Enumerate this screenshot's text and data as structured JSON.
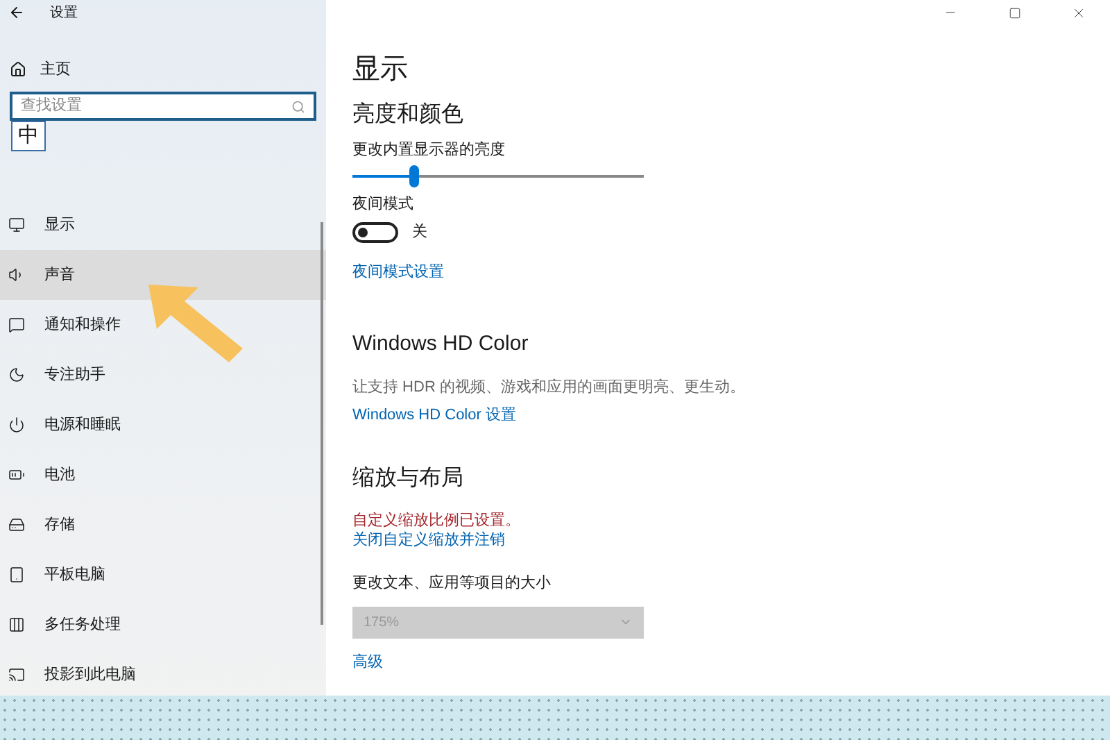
{
  "window": {
    "title": "设置"
  },
  "sidebar": {
    "home": "主页",
    "search": {
      "placeholder": "查找设置"
    },
    "ime": "中",
    "items": [
      {
        "label": "显示",
        "selected": false
      },
      {
        "label": "声音",
        "selected": true
      },
      {
        "label": "通知和操作",
        "selected": false
      },
      {
        "label": "专注助手",
        "selected": false
      },
      {
        "label": "电源和睡眠",
        "selected": false
      },
      {
        "label": "电池",
        "selected": false
      },
      {
        "label": "存储",
        "selected": false
      },
      {
        "label": "平板电脑",
        "selected": false
      },
      {
        "label": "多任务处理",
        "selected": false
      },
      {
        "label": "投影到此电脑",
        "selected": false
      }
    ]
  },
  "content": {
    "title": "显示",
    "brightness": {
      "heading": "亮度和颜色",
      "label": "更改内置显示器的亮度",
      "level": 0.21
    },
    "night_light": {
      "label": "夜间模式",
      "on": false,
      "state_text": "关",
      "link": "夜间模式设置"
    },
    "hd_color": {
      "heading": "Windows HD Color",
      "description": "让支持 HDR 的视频、游戏和应用的画面更明亮、更生动。",
      "link": "Windows HD Color 设置"
    },
    "scale": {
      "heading": "缩放与布局",
      "warning": "自定义缩放比例已设置。",
      "link": "关闭自定义缩放并注销",
      "label": "更改文本、应用等项目的大小",
      "dropdown": {
        "value": "175%",
        "disabled": true
      },
      "advanced_link": "高级"
    }
  }
}
